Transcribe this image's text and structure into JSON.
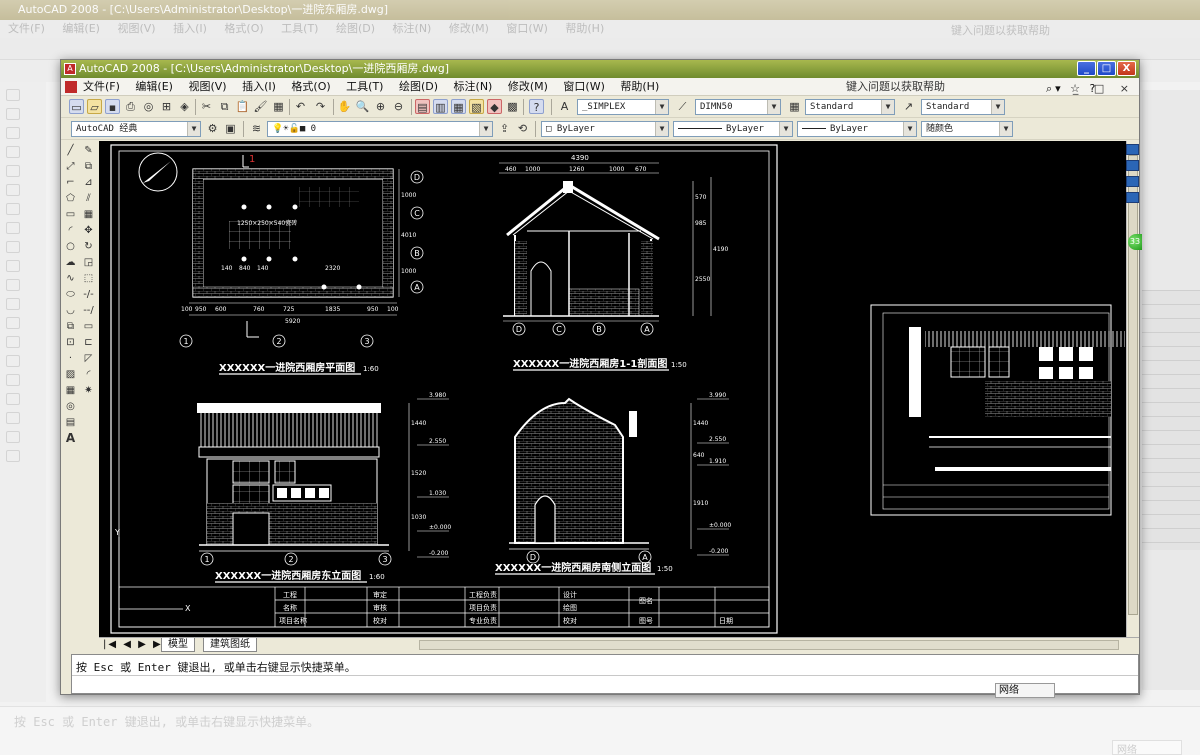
{
  "background": {
    "title": "AutoCAD 2008 - [C:\\Users\\Administrator\\Desktop\\一进院东厢房.dwg]",
    "menu": [
      "文件(F)",
      "编辑(E)",
      "视图(V)",
      "插入(I)",
      "格式(O)",
      "工具(T)",
      "绘图(D)",
      "标注(N)",
      "修改(M)",
      "窗口(W)",
      "帮助(H)"
    ],
    "help_text": "键入问题以获取帮助",
    "command_text": "按 Esc 或 Enter 键退出, 或单击右键显示快捷菜单。",
    "net_label": "网络"
  },
  "window": {
    "title": "AutoCAD 2008 - [C:\\Users\\Administrator\\Desktop\\一进院西厢房.dwg]",
    "controls": [
      "_",
      "□",
      "X"
    ]
  },
  "menu": {
    "items": [
      "文件(F)",
      "编辑(E)",
      "视图(V)",
      "插入(I)",
      "格式(O)",
      "工具(T)",
      "绘图(D)",
      "标注(N)",
      "修改(M)",
      "窗口(W)",
      "帮助(H)"
    ],
    "help_box": "键入问题以获取帮助"
  },
  "toolbar": {
    "text_style": "_SIMPLEX",
    "dim_style": "DIMN50",
    "table_style": "Standard",
    "multileader_style": "Standard",
    "workspace": "AutoCAD 经典",
    "layer": "0",
    "color": "ByLayer",
    "linetype": "ByLayer",
    "lineweight": "ByLayer",
    "plot_style": "随颜色"
  },
  "drawing": {
    "plan": {
      "title": "XXXXXX一进院西厢房平面图",
      "scale": "1:60",
      "grid_bottom": [
        "1",
        "2",
        "3"
      ],
      "grid_right": [
        "D",
        "C",
        "B",
        "A"
      ],
      "dims_bottom": [
        "100",
        "950",
        "600",
        "760",
        "725",
        "1835",
        "950",
        "100"
      ],
      "total": "5920",
      "note": "1250×250×540瓷砖",
      "dims_inner": [
        "140",
        "840",
        "140",
        "2320"
      ],
      "dims_right": [
        "1000",
        "4010",
        "1000"
      ]
    },
    "section": {
      "title": "XXXXXX一进院西厢房1-1剖面图",
      "scale": "1:50",
      "top_total": "4390",
      "top_dims": [
        "460",
        "1000",
        "1260",
        "1000",
        "670"
      ],
      "grid": [
        "D",
        "C",
        "B",
        "A"
      ],
      "right_dims": [
        "570",
        "985",
        "2550",
        "4190"
      ]
    },
    "east_elev": {
      "title": "XXXXXX一进院西厢房东立面图",
      "scale": "1:60",
      "levels": [
        "3.980",
        "2.550",
        "1.030",
        "±0.000",
        "-0.200"
      ],
      "dims": [
        "1440",
        "1520",
        "1030"
      ],
      "grid": [
        "1",
        "2",
        "3"
      ]
    },
    "south_elev": {
      "title": "XXXXXX一进院西厢房南侧立面图",
      "scale": "1:50",
      "levels": [
        "3.990",
        "2.550",
        "1.910",
        "±0.000",
        "-0.200"
      ],
      "dims": [
        "1440",
        "640",
        "1910"
      ],
      "grid": [
        "D",
        "A"
      ]
    },
    "title_block": {
      "col1": [
        "工程",
        "名称",
        "项目名称"
      ],
      "col2": [
        "审定",
        "审核",
        "校对"
      ],
      "col3": [
        "工程负责",
        "项目负责",
        "专业负责"
      ],
      "col4": [
        "设计",
        "绘图",
        "校对"
      ],
      "col5": [
        "图名",
        "图号",
        "日期"
      ]
    },
    "marker": "1"
  },
  "tabs": {
    "nav": "|◀ ◀ ▶ ▶|",
    "items": [
      "模型",
      "建筑图纸"
    ]
  },
  "command": {
    "text": "按 Esc 或 Enter 键退出, 或单击右键显示快捷菜单。",
    "net_label": "网络"
  }
}
